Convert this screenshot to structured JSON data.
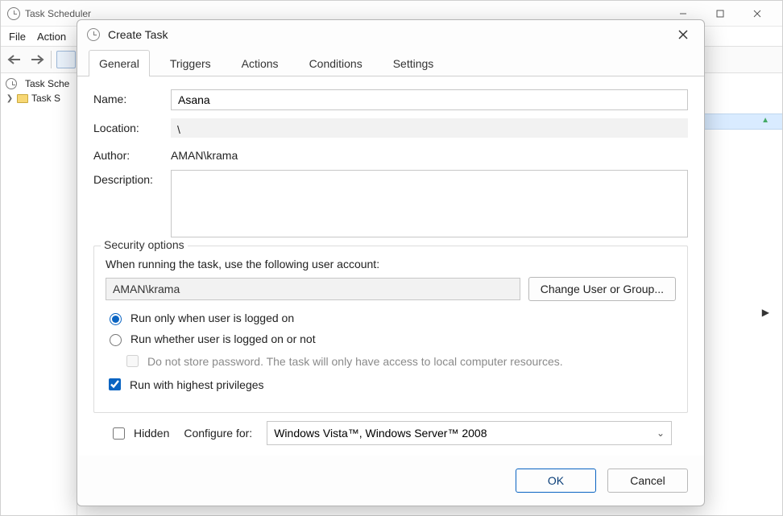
{
  "main_window": {
    "title": "Task Scheduler",
    "menu": {
      "file": "File",
      "action": "Action"
    },
    "tree": {
      "root": "Task Sche",
      "lib": "Task S"
    }
  },
  "dialog": {
    "title": "Create Task",
    "tabs": {
      "general": "General",
      "triggers": "Triggers",
      "actions": "Actions",
      "conditions": "Conditions",
      "settings": "Settings"
    },
    "labels": {
      "name": "Name:",
      "location": "Location:",
      "author": "Author:",
      "description": "Description:"
    },
    "values": {
      "name": "Asana",
      "location": "\\",
      "author": "AMAN\\krama",
      "description": ""
    },
    "security": {
      "group_title": "Security options",
      "prompt": "When running the task, use the following user account:",
      "account": "AMAN\\krama",
      "change_btn": "Change User or Group...",
      "radio_logged_on": "Run only when user is logged on",
      "radio_whether": "Run whether user is logged on or not",
      "no_store_pw": "Do not store password.  The task will only have access to local computer resources.",
      "highest_priv": "Run with highest privileges"
    },
    "bottom": {
      "hidden": "Hidden",
      "configure_for": "Configure for:",
      "configure_value": "Windows Vista™, Windows Server™ 2008"
    },
    "buttons": {
      "ok": "OK",
      "cancel": "Cancel"
    }
  }
}
